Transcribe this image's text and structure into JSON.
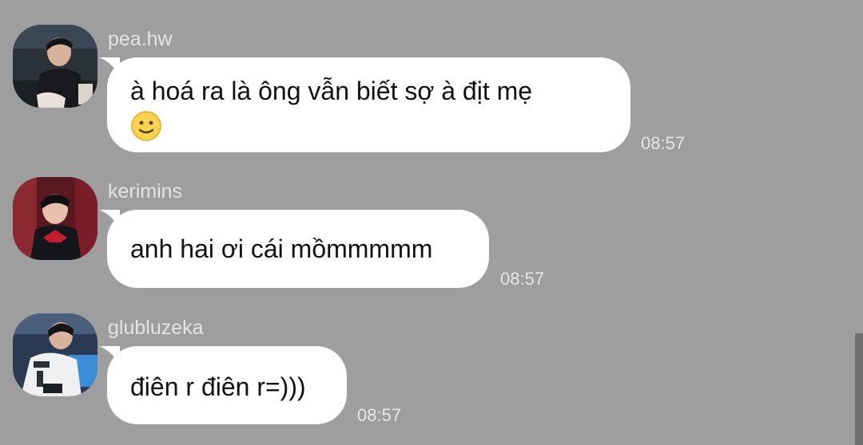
{
  "messages": [
    {
      "username": "pea.hw",
      "text": "à hoá ra là ông vẫn biết sợ à địt mẹ",
      "emoji": "slightly-smiling-face",
      "time": "08:57"
    },
    {
      "username": "kerimins",
      "text": "anh hai ơi cái mồmmmmm",
      "time": "08:57"
    },
    {
      "username": "glubluzeka",
      "text": "điên r điên r=)))",
      "time": "08:57"
    }
  ],
  "colors": {
    "background": "#9e9e9e",
    "bubble": "#ffffff",
    "username": "#e4e4e4",
    "time": "#e6e6e6",
    "text": "#111111"
  }
}
